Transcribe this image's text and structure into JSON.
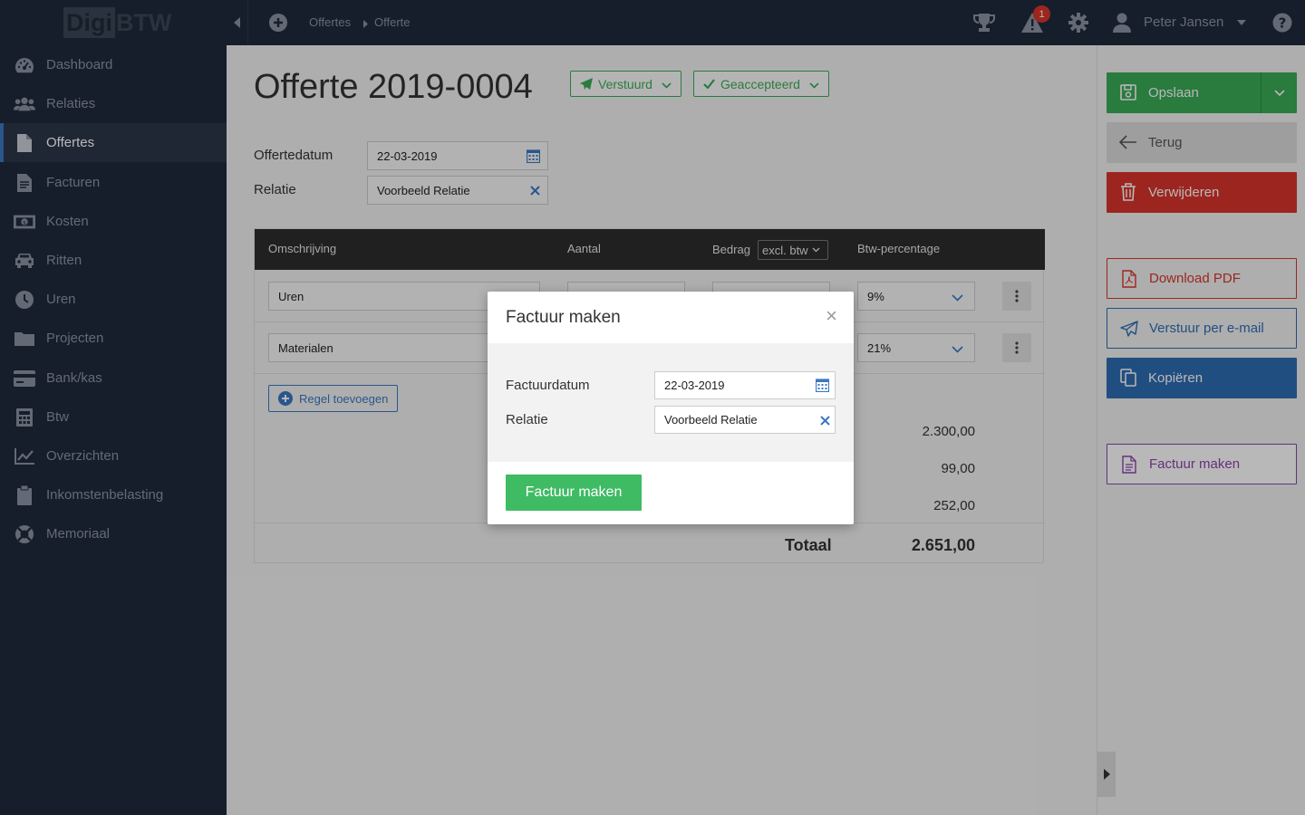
{
  "app": {
    "logo_part1": "Digi",
    "logo_part2": "BTW"
  },
  "sidebar": {
    "items": [
      {
        "label": "Dashboard",
        "icon": "dashboard-icon"
      },
      {
        "label": "Relaties",
        "icon": "users-icon"
      },
      {
        "label": "Offertes",
        "icon": "document-icon",
        "active": true
      },
      {
        "label": "Facturen",
        "icon": "invoice-icon"
      },
      {
        "label": "Kosten",
        "icon": "money-icon"
      },
      {
        "label": "Ritten",
        "icon": "car-icon"
      },
      {
        "label": "Uren",
        "icon": "clock-icon"
      },
      {
        "label": "Projecten",
        "icon": "folder-icon"
      },
      {
        "label": "Bank/kas",
        "icon": "credit-card-icon"
      },
      {
        "label": "Btw",
        "icon": "calculator-icon"
      },
      {
        "label": "Overzichten",
        "icon": "chart-line-icon"
      },
      {
        "label": "Inkomstenbelasting",
        "icon": "clipboard-icon"
      },
      {
        "label": "Memoriaal",
        "icon": "lifebuoy-icon"
      }
    ]
  },
  "topbar": {
    "breadcrumbs": [
      "Offertes",
      "Offerte"
    ],
    "notification_count": "1",
    "user_name": "Peter Jansen"
  },
  "page": {
    "title": "Offerte 2019-0004",
    "status_sent": "Verstuurd",
    "status_accepted": "Geaccepteerd",
    "date_label": "Offertedatum",
    "date_value": "22-03-2019",
    "relation_label": "Relatie",
    "relation_value": "Voorbeeld Relatie"
  },
  "table": {
    "headers": {
      "description": "Omschrijving",
      "quantity": "Aantal",
      "amount": "Bedrag",
      "vat": "Btw-percentage"
    },
    "amount_mode": "excl. btw",
    "rows": [
      {
        "description": "Uren",
        "vat": "9%"
      },
      {
        "description": "Materialen",
        "vat": "21%"
      }
    ],
    "add_row_label": "Regel toevoegen",
    "subtotals": [
      "2.300,00",
      "99,00",
      "252,00"
    ],
    "total_label": "Totaal",
    "total_value": "2.651,00"
  },
  "actions": {
    "save": "Opslaan",
    "back": "Terug",
    "delete": "Verwijderen",
    "download_pdf": "Download PDF",
    "send_email": "Verstuur per e-mail",
    "copy": "Kopiëren",
    "make_invoice": "Factuur maken"
  },
  "modal": {
    "title": "Factuur maken",
    "close": "×",
    "date_label": "Factuurdatum",
    "date_value": "22-03-2019",
    "relation_label": "Relatie",
    "relation_value": "Voorbeeld Relatie",
    "submit": "Factuur maken"
  },
  "colors": {
    "sidebar_bg": "#1f2a3c",
    "green": "#3bab57",
    "red": "#d9352b",
    "blue": "#2f6db3",
    "purple": "#8e44ad"
  }
}
